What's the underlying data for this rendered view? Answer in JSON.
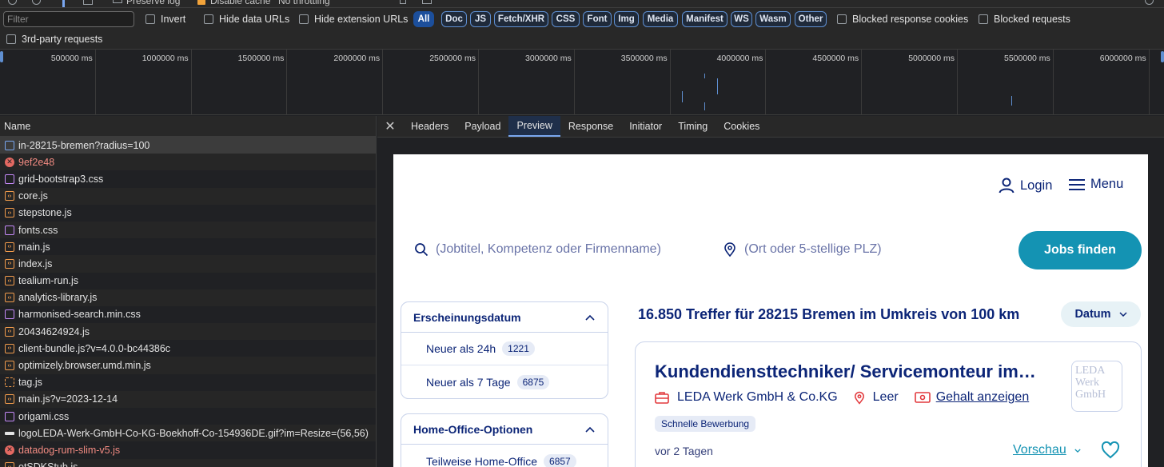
{
  "toolbar": {
    "preserve_log": "Preserve log",
    "disable_cache": "Disable cache",
    "throttling": "No throttling"
  },
  "filterbar": {
    "filter_placeholder": "Filter",
    "invert": "Invert",
    "hide_data_urls": "Hide data URLs",
    "hide_extension_urls": "Hide extension URLs",
    "types": [
      "All",
      "Doc",
      "JS",
      "Fetch/XHR",
      "CSS",
      "Font",
      "Img",
      "Media",
      "Manifest",
      "WS",
      "Wasm",
      "Other"
    ],
    "active_type": "All",
    "blocked_response_cookies": "Blocked response cookies",
    "blocked_requests": "Blocked requests",
    "third_party": "3rd-party requests"
  },
  "timeline": {
    "ticks": [
      "500000 ms",
      "1000000 ms",
      "1500000 ms",
      "2000000 ms",
      "2500000 ms",
      "3000000 ms",
      "3500000 ms",
      "4000000 ms",
      "4500000 ms",
      "5000000 ms",
      "5500000 ms",
      "6000000 ms"
    ]
  },
  "requests": {
    "header": "Name",
    "items": [
      {
        "name": "in-28215-bremen?radius=100",
        "type": "doc",
        "selected": true,
        "error": false
      },
      {
        "name": "9ef2e48",
        "type": "err",
        "selected": false,
        "error": true
      },
      {
        "name": "grid-bootstrap3.css",
        "type": "css",
        "selected": false,
        "error": false
      },
      {
        "name": "core.js",
        "type": "js",
        "selected": false,
        "error": false
      },
      {
        "name": "stepstone.js",
        "type": "js",
        "selected": false,
        "error": false
      },
      {
        "name": "fonts.css",
        "type": "css",
        "selected": false,
        "error": false
      },
      {
        "name": "main.js",
        "type": "js",
        "selected": false,
        "error": false
      },
      {
        "name": "index.js",
        "type": "js",
        "selected": false,
        "error": false
      },
      {
        "name": "tealium-run.js",
        "type": "js",
        "selected": false,
        "error": false
      },
      {
        "name": "analytics-library.js",
        "type": "js",
        "selected": false,
        "error": false
      },
      {
        "name": "harmonised-search.min.css",
        "type": "css",
        "selected": false,
        "error": false
      },
      {
        "name": "20434624924.js",
        "type": "js",
        "selected": false,
        "error": false
      },
      {
        "name": "client-bundle.js?v=4.0.0-bc44386c",
        "type": "js",
        "selected": false,
        "error": false
      },
      {
        "name": "optimizely.browser.umd.min.js",
        "type": "js",
        "selected": false,
        "error": false
      },
      {
        "name": "tag.js",
        "type": "jsd",
        "selected": false,
        "error": false
      },
      {
        "name": "main.js?v=2023-12-14",
        "type": "js",
        "selected": false,
        "error": false
      },
      {
        "name": "origami.css",
        "type": "css",
        "selected": false,
        "error": false
      },
      {
        "name": "logoLEDA-Werk-GmbH-Co-KG-Boekhoff-Co-154936DE.gif?im=Resize=(56,56)",
        "type": "img",
        "selected": false,
        "error": false
      },
      {
        "name": "datadog-rum-slim-v5.js",
        "type": "err",
        "selected": false,
        "error": true
      },
      {
        "name": "otSDKStub.js",
        "type": "js",
        "selected": false,
        "error": false
      }
    ]
  },
  "detail_tabs": {
    "items": [
      "Headers",
      "Payload",
      "Preview",
      "Response",
      "Initiator",
      "Timing",
      "Cookies"
    ],
    "active": "Preview"
  },
  "preview": {
    "login": "Login",
    "menu": "Menu",
    "search_what_placeholder": "(Jobtitel, Kompetenz oder Firmenname)",
    "search_where_placeholder": "(Ort oder 5-stellige PLZ)",
    "search_button": "Jobs finden",
    "facets": [
      {
        "title": "Erscheinungsdatum",
        "options": [
          {
            "label": "Neuer als 24h",
            "count": "1221"
          },
          {
            "label": "Neuer als 7 Tage",
            "count": "6875"
          }
        ]
      },
      {
        "title": "Home-Office-Optionen",
        "options": [
          {
            "label": "Teilweise Home-Office",
            "count": "6857"
          }
        ]
      }
    ],
    "results_heading": "16.850 Treffer für 28215 Bremen im Umkreis von 100 km",
    "sort_label": "Datum",
    "job": {
      "title": "Kundendiensttechniker/ Servicemonteur im…",
      "company": "LEDA Werk GmbH & Co.KG",
      "location": "Leer",
      "salary": "Gehalt anzeigen",
      "badge": "Schnelle Bewerbung",
      "posted": "vor 2 Tagen",
      "preview_link": "Vorschau",
      "logo_alt": "LEDA Werk GmbH"
    },
    "colors": {
      "brand": "#0c2577",
      "accent": "#1493b3"
    }
  }
}
